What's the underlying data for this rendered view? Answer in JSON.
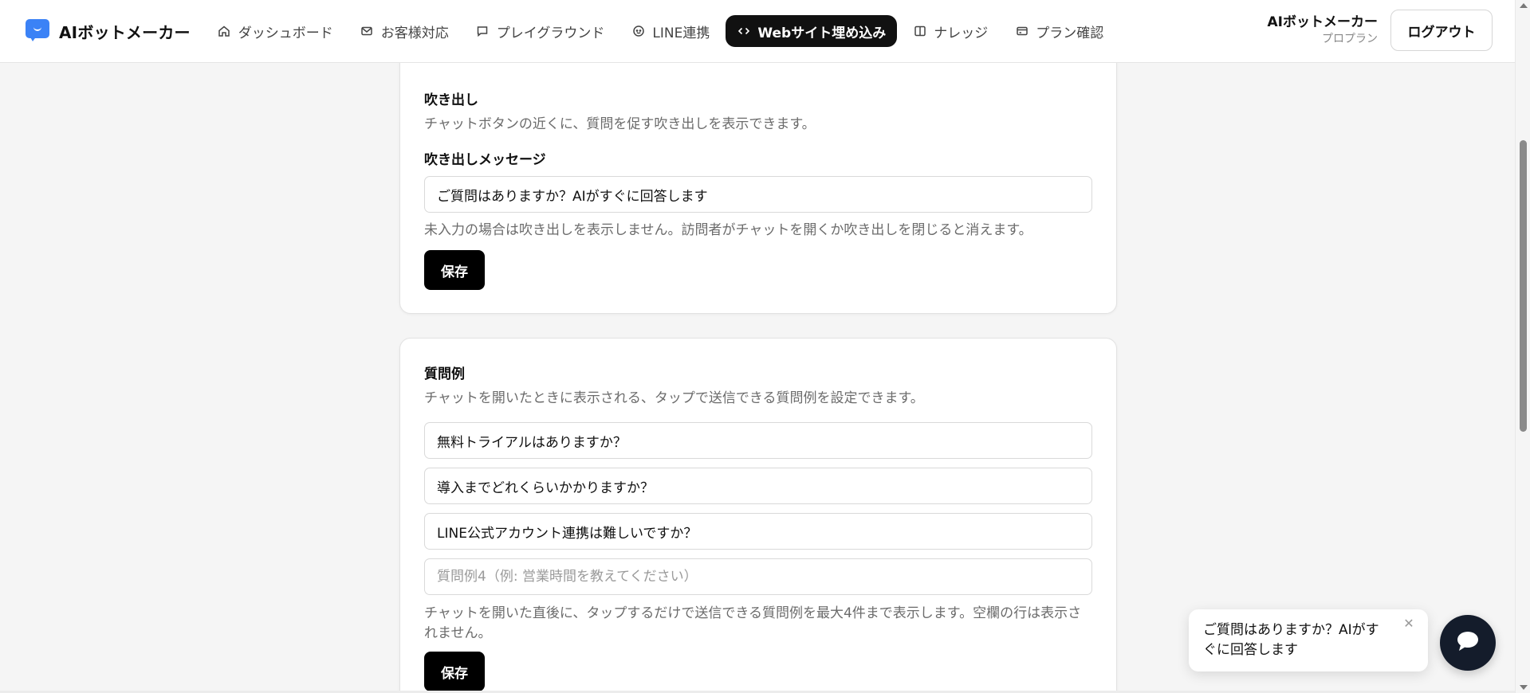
{
  "brand": {
    "name": "AIボットメーカー"
  },
  "nav": [
    {
      "label": "ダッシュボード",
      "icon": "home-icon"
    },
    {
      "label": "お客様対応",
      "icon": "mail-icon"
    },
    {
      "label": "プレイグラウンド",
      "icon": "chat-icon"
    },
    {
      "label": "LINE連携",
      "icon": "smile-circle-icon"
    },
    {
      "label": "Webサイト埋め込み",
      "icon": "code-icon",
      "active": true
    },
    {
      "label": "ナレッジ",
      "icon": "book-icon"
    },
    {
      "label": "プラン確認",
      "icon": "card-icon"
    }
  ],
  "user": {
    "name": "AIボットメーカー",
    "plan": "プロプラン",
    "logout_label": "ログアウト"
  },
  "balloon_section": {
    "title": "吹き出し",
    "description": "チャットボタンの近くに、質問を促す吹き出しを表示できます。",
    "field_label": "吹き出しメッセージ",
    "message_value": "ご質問はありますか？AIがすぐに回答します",
    "hint": "未入力の場合は吹き出しを表示しません。訪問者がチャットを開くか吹き出しを閉じると消えます。",
    "save_label": "保存"
  },
  "examples_section": {
    "title": "質問例",
    "description": "チャットを開いたときに表示される、タップで送信できる質問例を設定できます。",
    "questions": [
      {
        "value": "無料トライアルはありますか？",
        "placeholder": ""
      },
      {
        "value": "導入までどれくらいかかりますか？",
        "placeholder": ""
      },
      {
        "value": "LINE公式アカウント連携は難しいですか？",
        "placeholder": ""
      },
      {
        "value": "",
        "placeholder": "質問例4（例: 営業時間を教えてください）"
      }
    ],
    "hint": "チャットを開いた直後に、タップするだけで送信できる質問例を最大4件まで表示します。空欄の行は表示されません。",
    "save_label": "保存"
  },
  "floating_bubble": {
    "text": "ご質問はありますか？AIがすぐに回答します",
    "close_symbol": "✕"
  },
  "colors": {
    "accent": "#111111",
    "brand_blue": "#3b82f6",
    "fab": "#141c2b"
  }
}
